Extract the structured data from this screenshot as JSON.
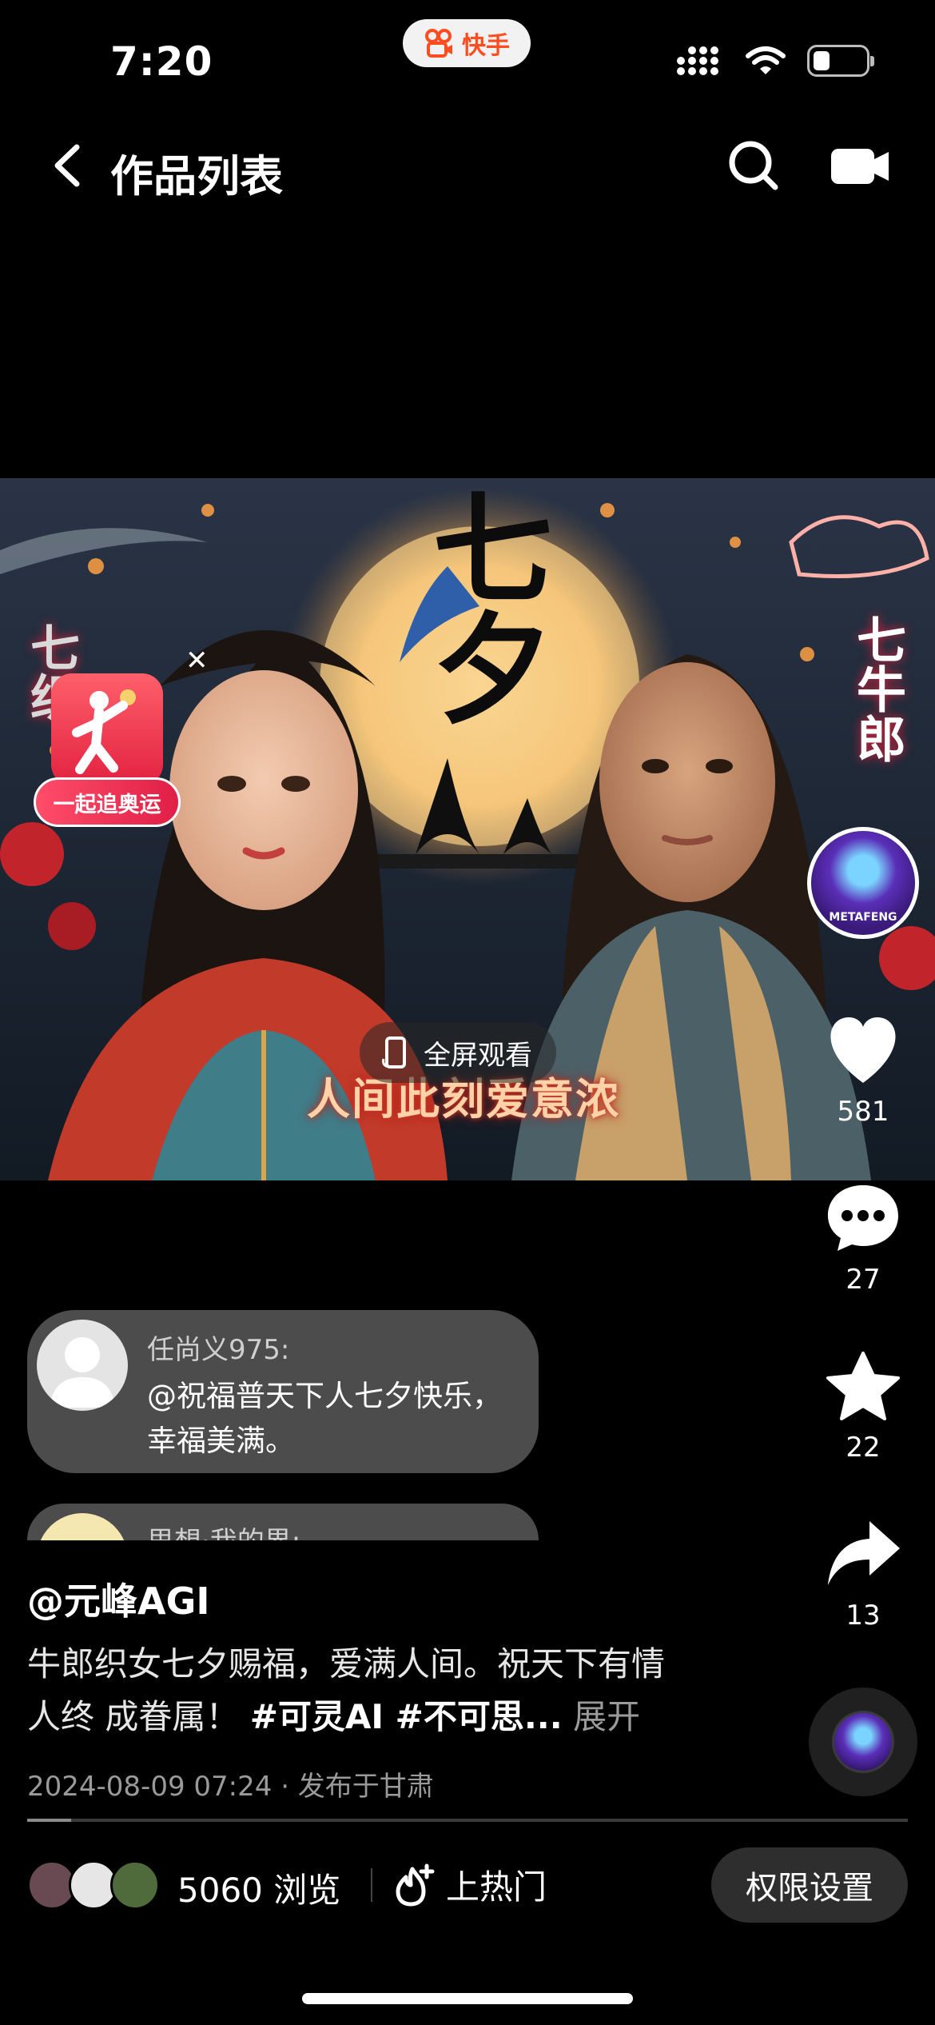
{
  "status_bar": {
    "time": "7:20",
    "app_pill": "快手",
    "icons": [
      "signal-icon",
      "wifi-icon",
      "battery-icon"
    ]
  },
  "nav": {
    "title": "作品列表",
    "icons": [
      "back-icon",
      "search-icon",
      "video-camera-icon"
    ]
  },
  "video": {
    "title_art": "七夕",
    "side_left": "七织",
    "side_right": "七牛郎",
    "caption": "人间此刻爱意浓",
    "fullscreen_label": "全屏观看",
    "olympic_badge": "一起追奥运",
    "author_avatar_text": "METAFENG"
  },
  "rail": {
    "likes": "581",
    "comments": "27",
    "favorites": "22",
    "shares": "13"
  },
  "comments": [
    {
      "name": "任尚义975:",
      "text": "@祝福普天下人七夕快乐，幸福美满。"
    },
    {
      "name": "思想·我的界:",
      "text": ""
    }
  ],
  "post": {
    "author": "@元峰AGI",
    "description": "牛郎织女七夕赐福，爱满人间。祝天下有情人终 成眷属！",
    "tags": "#可灵AI #不可思...",
    "more_label": "展开",
    "meta": "2024-08-09 07:24 · 发布于甘肃",
    "progress": 0.05
  },
  "bottom_bar": {
    "views": "5060 浏览",
    "hot_label": "上热门",
    "permission_label": "权限设置"
  },
  "colors": {
    "brand": "#ff4d1f",
    "olympic_red": "#e22240",
    "comment_bg": "#5f5f5f"
  }
}
